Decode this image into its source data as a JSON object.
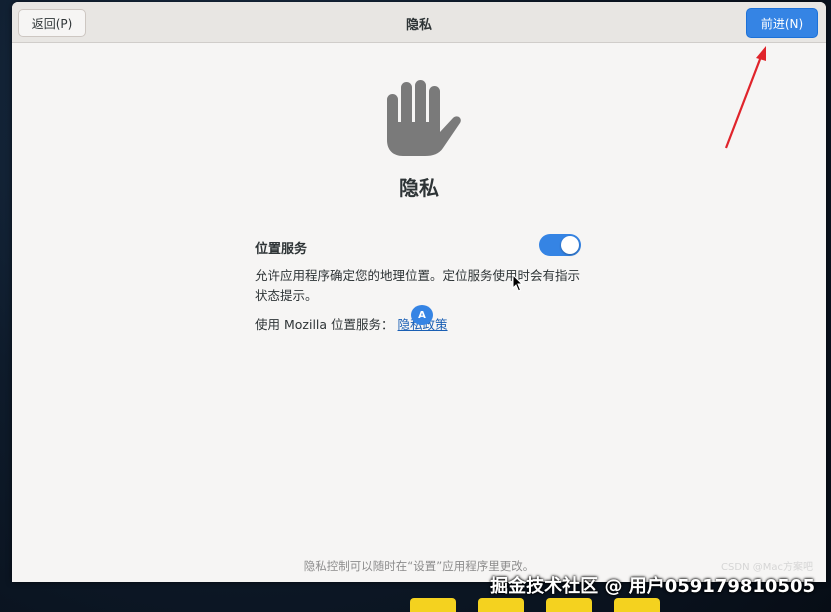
{
  "header": {
    "back_label": "返回(P)",
    "title": "隐私",
    "next_label": "前进(N)"
  },
  "page": {
    "heading": "隐私",
    "icon": "raised-hand-icon"
  },
  "location": {
    "label": "位置服务",
    "enabled": true,
    "description": "允许应用程序确定您的地理位置。定位服务使用时会有指示状态提示。",
    "mozilla_prefix": "使用 Mozilla 位置服务：",
    "policy_link": "隐私政策"
  },
  "osk_bubble": "A",
  "footer": "隐私控制可以随时在“设置”应用程序里更改。",
  "watermark": "掘金技术社区 @ 用户059179810505",
  "watermark_small": "CSDN @Mac方案吧",
  "colors": {
    "accent": "#3584e4",
    "annotation": "#e0242b",
    "hand_icon": "#7a7a7a"
  }
}
